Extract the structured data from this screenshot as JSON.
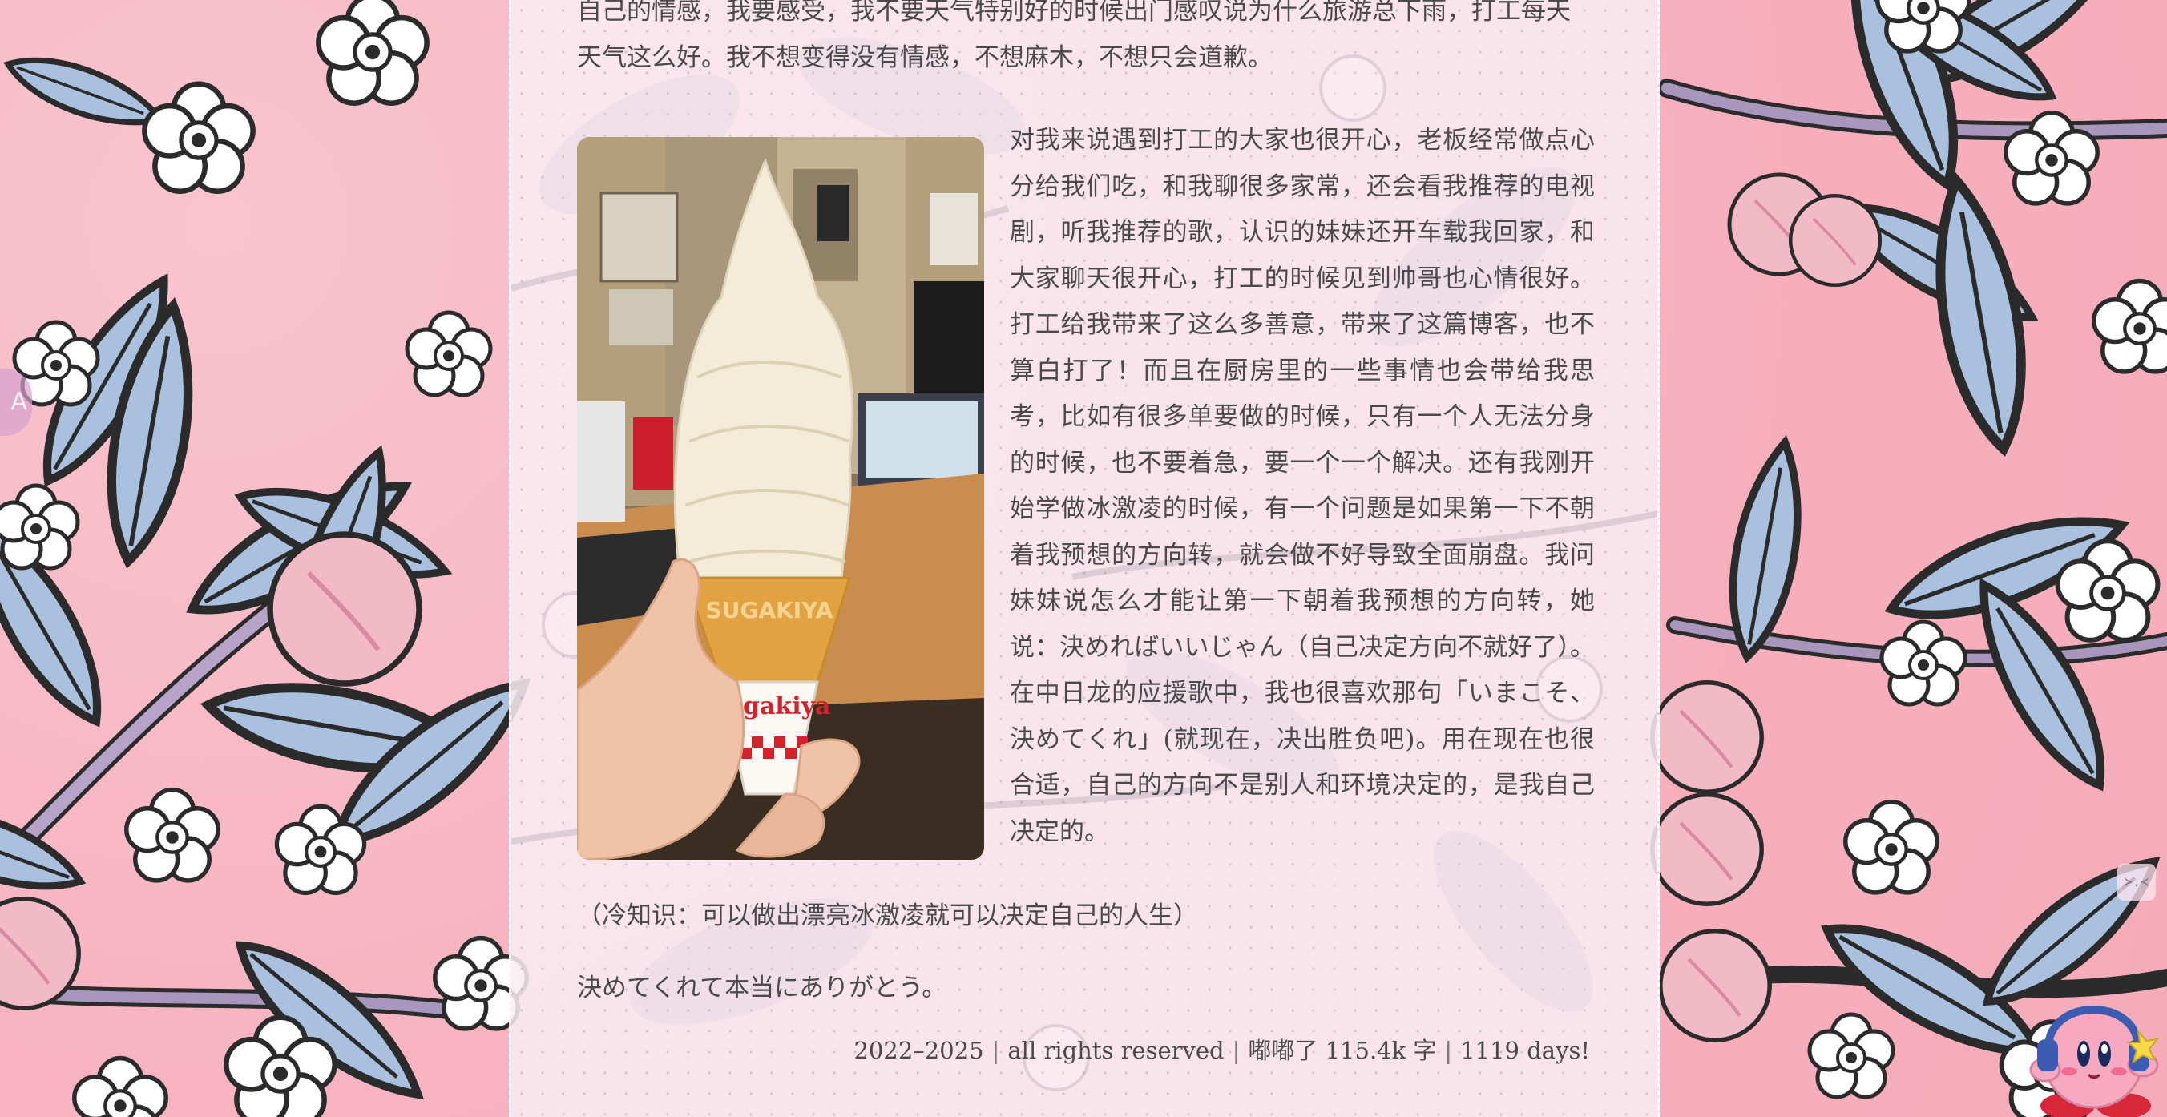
{
  "article": {
    "p_top": "自己的情感，我要感受，我不要天气特别好的时候出门感叹说为什么旅游总下雨，打工每天天气这么好。我不想变得没有情感，不想麻木，不想只会道歉。",
    "p_body": "对我来说遇到打工的大家也很开心，老板经常做点心分给我们吃，和我聊很多家常，还会看我推荐的电视剧，听我推荐的歌，认识的妹妹还开车载我回家，和大家聊天很开心，打工的时候见到帅哥也心情很好。打工给我带来了这么多善意，带来了这篇博客，也不算白打了！而且在厨房里的一些事情也会带给我思考，比如有很多单要做的时候，只有一个人无法分身的时候，也不要着急，要一个一个解决。还有我刚开始学做冰激凌的时候，有一个问题是如果第一下不朝着我预想的方向转，就会做不好导致全面崩盘。我问妹妹说怎么才能让第一下朝着我预想的方向转，她说：決めればいいじゃん（自己决定方向不就好了）。在中日龙的应援歌中，我也很喜欢那句「いまこそ、決めてくれ」(就现在，决出胜负吧)。用在现在也很合适，自己的方向不是别人和环境决定的，是我自己决定的。",
    "p_tip": "（冷知识：可以做出漂亮冰激凌就可以决定自己的人生）",
    "p_thanks": "決めてくれて本当にありがとう。"
  },
  "photo": {
    "cup_text": "Sugakiya",
    "cone_text": "SUGAKIYA"
  },
  "footer": {
    "years": "2022–2025",
    "rights": "all rights reserved",
    "word_count": "嘟嘟了 115.4k 字",
    "days": "1119 days!"
  },
  "widgets": {
    "edge_badge_text": "A",
    "emote_text": "≻.≺"
  },
  "colors": {
    "background_pink": "#f7b9c5",
    "paper": "#faecf2",
    "text": "#4a4a4a",
    "leaf_blue": "#a9c0de",
    "flower_white": "#ffffff",
    "peach": "#f2b3c2"
  },
  "icons": {
    "mascot": "kirby-with-headphones-icon",
    "emote": "emoticon-icon"
  }
}
